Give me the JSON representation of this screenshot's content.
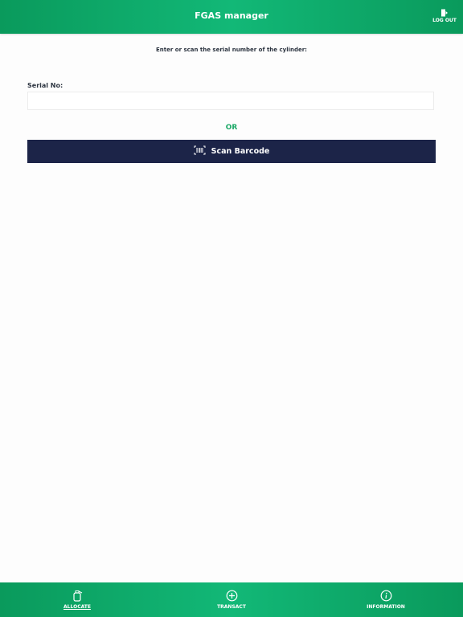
{
  "header": {
    "title": "FGAS manager",
    "logout_label": "LOG OUT"
  },
  "main": {
    "instruction": "Enter or scan the serial number of the cylinder:",
    "serial_label": "Serial No:",
    "serial_value": "",
    "serial_placeholder": "",
    "or_text": "OR",
    "scan_button_label": "Scan Barcode"
  },
  "tabs": [
    {
      "label": "ALLOCATE",
      "icon": "cylinder-icon",
      "active": true
    },
    {
      "label": "TRANSACT",
      "icon": "plus-circle-icon",
      "active": false
    },
    {
      "label": "INFORMATION",
      "icon": "info-circle-icon",
      "active": false
    }
  ],
  "colors": {
    "accent_green": "#12b877",
    "or_green": "#1aa866",
    "button_navy": "#1c2448",
    "text_dark": "#2c3440"
  }
}
